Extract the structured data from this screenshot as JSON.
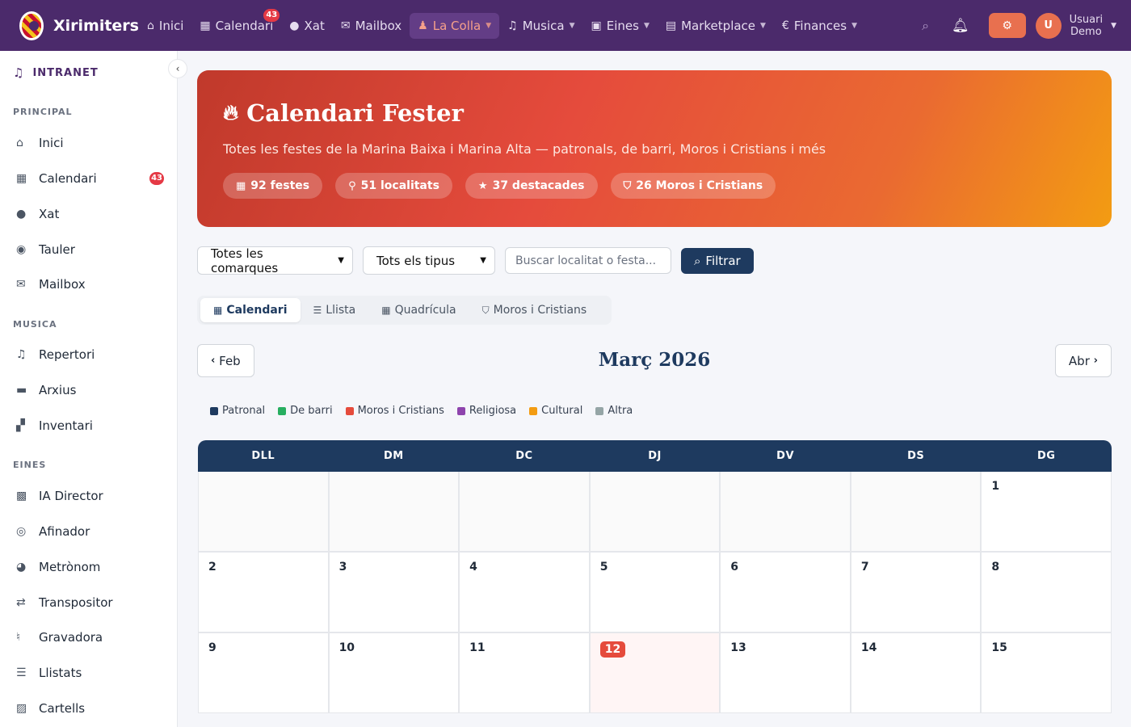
{
  "nav": {
    "brand": "Xirimiters",
    "items": [
      {
        "label": "Inici",
        "icon": "home-icon"
      },
      {
        "label": "Calendari",
        "icon": "calendar-icon",
        "badge": "43"
      },
      {
        "label": "Xat",
        "icon": "chat-icon"
      },
      {
        "label": "Mailbox",
        "icon": "mail-icon"
      },
      {
        "label": "La Colla",
        "icon": "users-icon"
      },
      {
        "label": "Musica",
        "icon": "music-icon"
      },
      {
        "label": "Eines",
        "icon": "toolbox-icon"
      },
      {
        "label": "Marketplace",
        "icon": "store-icon"
      },
      {
        "label": "Finances",
        "icon": "euro-icon"
      }
    ],
    "user_line1": "Usuari",
    "user_line2": "Demo",
    "avatar": "U"
  },
  "sidebar": {
    "title": "INTRANET",
    "sections": {
      "principal": "PRINCIPAL",
      "musica": "MUSICA",
      "eines": "EINES"
    },
    "items": [
      {
        "label": "Inici"
      },
      {
        "label": "Calendari",
        "badge": "43"
      },
      {
        "label": "Xat"
      },
      {
        "label": "Tauler"
      },
      {
        "label": "Mailbox"
      },
      {
        "label": "Repertori"
      },
      {
        "label": "Arxius"
      },
      {
        "label": "Inventari"
      },
      {
        "label": "IA Director"
      },
      {
        "label": "Afinador"
      },
      {
        "label": "Metrònom"
      },
      {
        "label": "Transpositor"
      },
      {
        "label": "Gravadora"
      },
      {
        "label": "Llistats"
      },
      {
        "label": "Cartells"
      }
    ]
  },
  "hero": {
    "title": "Calendari Fester",
    "subtitle": "Totes les festes de la Marina Baixa i Marina Alta — patronals, de barri, Moros i Cristians i més",
    "chips": [
      "92 festes",
      "51 localitats",
      "37 destacades",
      "26 Moros i Cristians"
    ]
  },
  "filters": {
    "comarca": "Totes les comarques",
    "tipus": "Tots els tipus",
    "search_placeholder": "Buscar localitat o festa...",
    "button": "Filtrar"
  },
  "tabs": [
    "Calendari",
    "Llista",
    "Quadrícula",
    "Moros i Cristians"
  ],
  "month": {
    "title": "Març 2026",
    "prev": "Feb",
    "next": "Abr"
  },
  "legend": [
    {
      "label": "Patronal",
      "color": "#1e3a5f"
    },
    {
      "label": "De barri",
      "color": "#27ae60"
    },
    {
      "label": "Moros i Cristians",
      "color": "#e54b3c"
    },
    {
      "label": "Religiosa",
      "color": "#8e44ad"
    },
    {
      "label": "Cultural",
      "color": "#f39c12"
    },
    {
      "label": "Altra",
      "color": "#95a5a6"
    }
  ],
  "calendar": {
    "weekdays": [
      "DLL",
      "DM",
      "DC",
      "DJ",
      "DV",
      "DS",
      "DG"
    ],
    "days": [
      "",
      "",
      "",
      "",
      "",
      "",
      "1",
      "2",
      "3",
      "4",
      "5",
      "6",
      "7",
      "8",
      "9",
      "10",
      "11",
      "12",
      "13",
      "14",
      "15"
    ],
    "today": "12"
  }
}
